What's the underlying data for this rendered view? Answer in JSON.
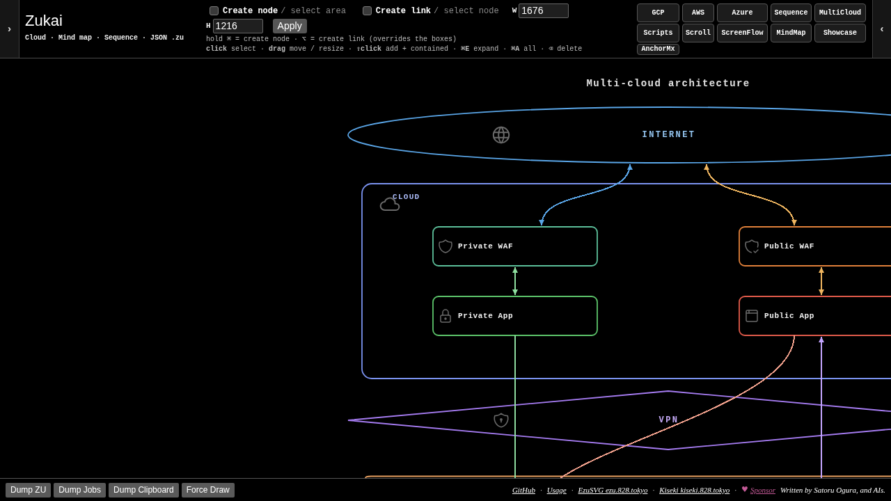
{
  "left_toggle": "›",
  "brand": {
    "logo": "Zukai",
    "tagline": "Cloud · Mind map · Sequence · JSON .zu"
  },
  "toolbar": {
    "modes": [
      {
        "label": "Create node",
        "hint": "/ select area",
        "checked": false
      },
      {
        "label": "Create link",
        "hint": "/ select node",
        "checked": false
      }
    ],
    "size_fields": [
      {
        "label": "W",
        "value": "1676"
      },
      {
        "label": "H",
        "value": "1216"
      }
    ],
    "apply_button": "Apply",
    "help": [
      "hold ⌘ = create node · ⌥ = create link (overrides the boxes)",
      "**click** select · **drag** move / resize · **⇧click** add + contained · **⌘E** expand · **⌘A** all · ⌫ delete"
    ]
  },
  "sample_buttons": [
    "GCP",
    "AWS",
    "Azure",
    "Sequence",
    "MultiCloud",
    "Scripts",
    "Scroll",
    "ScreenFlow",
    "MindMap",
    "Showcase",
    "AnchorMx"
  ],
  "right_toggle": "‹",
  "diagram": {
    "title": "Multi-cloud architecture",
    "nodes": [
      {
        "kind": "ellipse",
        "label": "INTERNET",
        "color": "#5aa6e8"
      },
      {
        "kind": "group",
        "label": "CLOUD",
        "color": "#7b93f0"
      },
      {
        "kind": "box",
        "label": "Private WAF",
        "color": "#5cbf9a"
      },
      {
        "kind": "box",
        "label": "Public WAF",
        "color": "#e0803a"
      },
      {
        "kind": "box",
        "label": "Private App",
        "color": "#5cc46a"
      },
      {
        "kind": "box",
        "label": "Public App",
        "color": "#e05a4a"
      },
      {
        "kind": "diamond",
        "label": "VPN",
        "color": "#a67cf2"
      },
      {
        "kind": "box",
        "color": "#e8a060"
      }
    ],
    "links": [
      {
        "color": "#5aa6e8",
        "start_arrow": true,
        "end_arrow": true
      },
      {
        "color": "#f0b660",
        "start_arrow": true,
        "end_arrow": true
      },
      {
        "color": "#8fe0a0",
        "start_arrow": true,
        "end_arrow": true
      },
      {
        "color": "#f0b660",
        "start_arrow": true,
        "end_arrow": true
      },
      {
        "color": "#8fdca0",
        "start_arrow": false,
        "end_arrow": false
      },
      {
        "color": "#f0a08c",
        "start_arrow": false,
        "end_arrow": false
      },
      {
        "color": "#c4a6ff",
        "start_arrow": false,
        "end_arrow": true
      }
    ]
  },
  "footer": {
    "buttons": [
      "Dump ZU",
      "Dump Jobs",
      "Dump Clipboard",
      "Force Draw"
    ],
    "credits": [
      {
        "kind": "link",
        "text": "GitHub"
      },
      {
        "kind": "separator",
        "text": "·"
      },
      {
        "kind": "link",
        "text": "Usage"
      },
      {
        "kind": "separator",
        "text": "·"
      },
      {
        "kind": "link",
        "text": "EzuSVG ezu.828.tokyo"
      },
      {
        "kind": "separator",
        "text": "·"
      },
      {
        "kind": "link",
        "text": "Kiseki kiseki.828.tokyo"
      },
      {
        "kind": "separator",
        "text": "·"
      },
      {
        "kind": "sponsor",
        "icon": "♥",
        "text": "Sponsor"
      },
      {
        "kind": "credit",
        "text": "Written by Satoru Ogura, and AIs."
      }
    ]
  }
}
